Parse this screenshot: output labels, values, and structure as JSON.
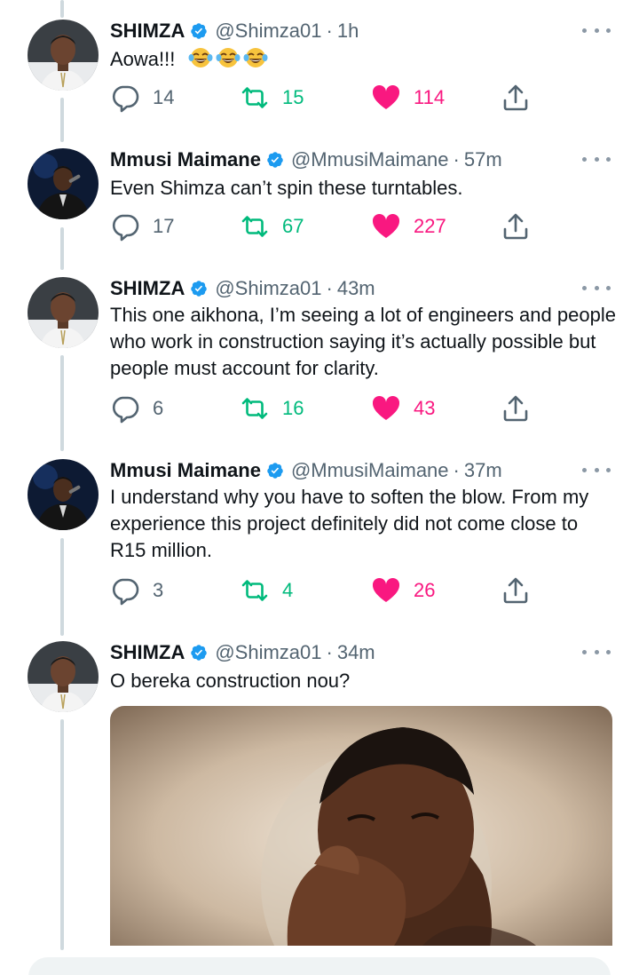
{
  "colors": {
    "verified": "#1d9bf0",
    "retweet": "#00ba7c",
    "like": "#f91880",
    "meta": "#536471",
    "thread_line": "#cfd9de"
  },
  "icons": {
    "reply": "reply-icon",
    "retweet": "retweet-icon",
    "like": "heart-icon",
    "share": "share-icon",
    "more": "more-options-icon",
    "verified": "verified-badge-icon"
  },
  "tweets": [
    {
      "name": "SHIMZA",
      "handle": "@Shimza01",
      "dot": "·",
      "time": "1h",
      "text": "Aowa!!!",
      "emoji": [
        "face-with-tears-of-joy",
        "face-with-tears-of-joy",
        "face-with-tears-of-joy"
      ],
      "replies": "14",
      "retweets": "15",
      "likes": "114"
    },
    {
      "name": "Mmusi Maimane",
      "handle": "@MmusiMaimane",
      "dot": "·",
      "time": "57m",
      "text": "Even Shimza can’t spin these turntables.",
      "replies": "17",
      "retweets": "67",
      "likes": "227"
    },
    {
      "name": "SHIMZA",
      "handle": "@Shimza01",
      "dot": "·",
      "time": "43m",
      "text": "This one aikhona, I’m seeing a lot of engineers and people who work in construction saying it’s actually possible but people must account for clarity.",
      "replies": "6",
      "retweets": "16",
      "likes": "43"
    },
    {
      "name": "Mmusi Maimane",
      "handle": "@MmusiMaimane",
      "dot": "·",
      "time": "37m",
      "text": "I understand why you have to soften the blow. From my experience this project definitely did not come close to R15 million.",
      "replies": "3",
      "retweets": "4",
      "likes": "26"
    },
    {
      "name": "SHIMZA",
      "handle": "@Shimza01",
      "dot": "·",
      "time": "34m",
      "text": "O bereka construction nou?",
      "media": "gif-person-laughing-behind-hand"
    }
  ]
}
